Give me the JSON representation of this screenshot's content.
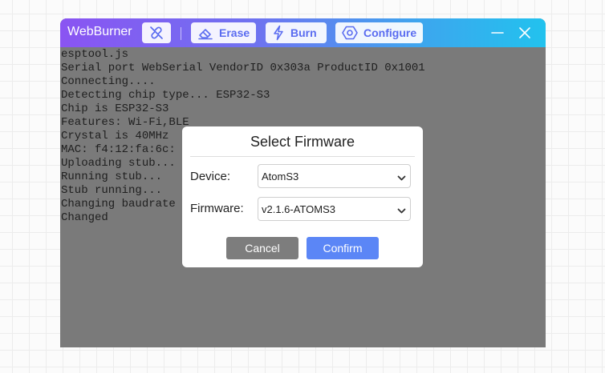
{
  "app": {
    "title": "WebBurner"
  },
  "toolbar": {
    "link_icon": "link-off-icon",
    "buttons": [
      {
        "label": "Erase",
        "icon": "eraser-icon"
      },
      {
        "label": "Burn",
        "icon": "lightning-icon"
      },
      {
        "label": "Configure",
        "icon": "hexagon-gear-icon"
      }
    ],
    "accent_color": "#5a6cf0"
  },
  "window_controls": {
    "minimize_icon": "minimize-icon",
    "close_icon": "close-icon"
  },
  "console": {
    "lines": [
      "esptool.js",
      "Serial port WebSerial VendorID 0x303a ProductID 0x1001",
      "Connecting....",
      "Detecting chip type... ESP32-S3",
      "Chip is ESP32-S3",
      "Features: Wi-Fi,BLE",
      "Crystal is 40MHz",
      "MAC: f4:12:fa:6c:",
      "Uploading stub...",
      "Running stub...",
      "Stub running...",
      "Changing baudrate",
      "Changed"
    ]
  },
  "modal": {
    "title": "Select Firmware",
    "device_label": "Device:",
    "device_value": "AtomS3",
    "firmware_label": "Firmware:",
    "firmware_value": "v2.1.6-ATOMS3",
    "cancel_label": "Cancel",
    "confirm_label": "Confirm",
    "confirm_color": "#5b86f6",
    "cancel_color": "#7d7d7d"
  }
}
